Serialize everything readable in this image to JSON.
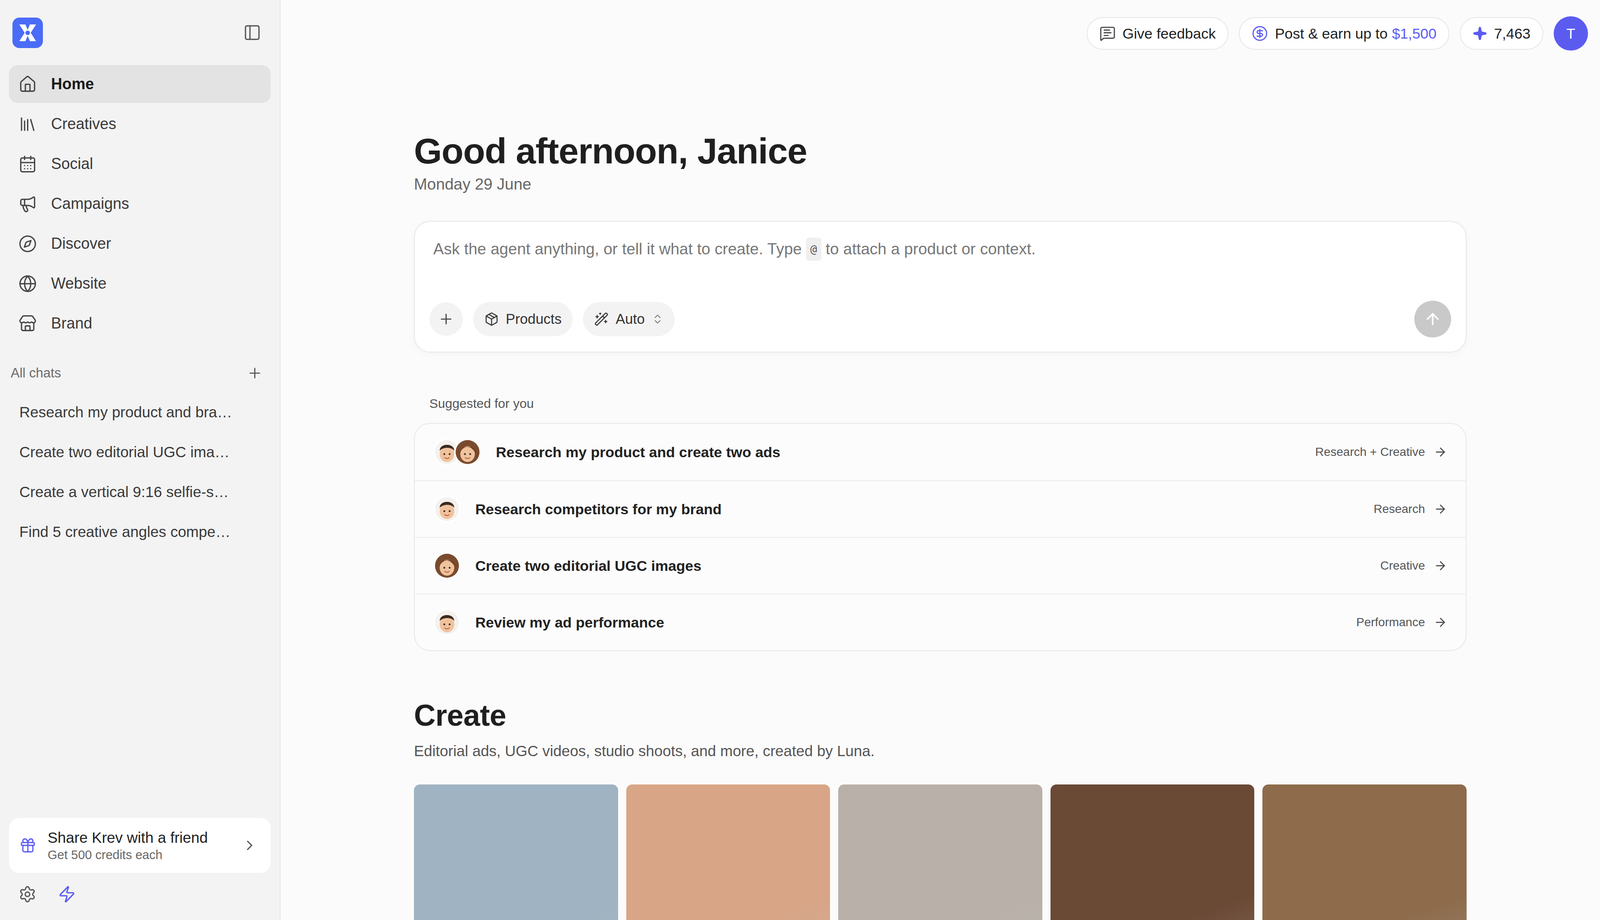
{
  "sidebar": {
    "nav": [
      {
        "label": "Home",
        "selected": true
      },
      {
        "label": "Creatives",
        "selected": false
      },
      {
        "label": "Social",
        "selected": false
      },
      {
        "label": "Campaigns",
        "selected": false
      },
      {
        "label": "Discover",
        "selected": false
      },
      {
        "label": "Website",
        "selected": false
      },
      {
        "label": "Brand",
        "selected": false
      }
    ],
    "chats_header": "All chats",
    "chats": [
      "Research my product and bra…",
      "Create two editorial UGC ima…",
      "Create a vertical 9:16 selfie-s…",
      "Find 5 creative angles compe…"
    ],
    "share": {
      "title": "Share Krev with a friend",
      "subtitle": "Get 500 credits each"
    }
  },
  "topbar": {
    "feedback": "Give feedback",
    "earn": {
      "text": "Post & earn up to",
      "amount": "$1,500"
    },
    "credits": "7,463",
    "avatar": "T"
  },
  "greeting": "Good afternoon, Janice",
  "date": "Monday 29 June",
  "prompt": {
    "placeholder_before": "Ask the agent anything, or tell it what to create. Type",
    "key": "@",
    "placeholder_after": "to attach a product or context.",
    "buttons": [
      {
        "label": "Products"
      },
      {
        "label": "Auto"
      }
    ]
  },
  "suggested": {
    "title": "Suggested for you",
    "items": [
      {
        "label": "Research my product and create two ads",
        "tag": "Research + Creative",
        "avatars": [
          "man",
          "woman"
        ]
      },
      {
        "label": "Research competitors for my brand",
        "tag": "Research",
        "avatars": [
          "man"
        ]
      },
      {
        "label": "Create two editorial UGC images",
        "tag": "Creative",
        "avatars": [
          "woman"
        ]
      },
      {
        "label": "Review my ad performance",
        "tag": "Performance",
        "avatars": [
          "man"
        ]
      }
    ]
  },
  "create": {
    "title": "Create",
    "subtitle": "Editorial ads, UGC videos, studio shoots, and more, created by Luna.",
    "tiles": [
      {
        "color": "#9fb3c2"
      },
      {
        "color": "#d8a586"
      },
      {
        "color": "#b9b1a9"
      },
      {
        "color": "#6a4935"
      },
      {
        "color": "#8d6b4b"
      }
    ]
  }
}
